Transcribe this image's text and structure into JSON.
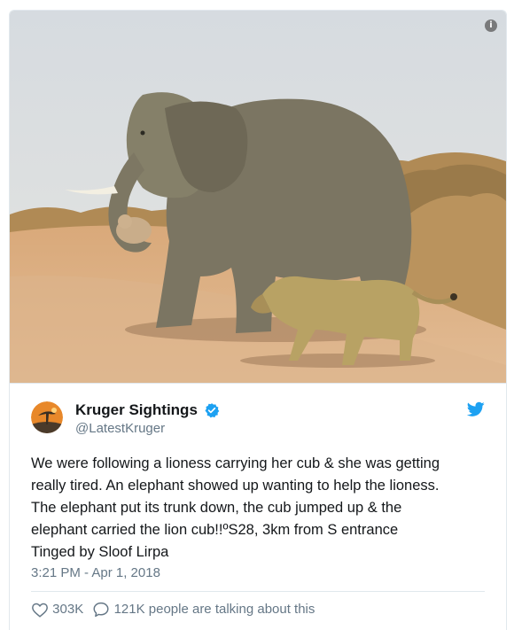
{
  "media": {
    "alt": "elephant-carrying-lion-cub-photo",
    "info_icon": "info-icon"
  },
  "author": {
    "display_name": "Kruger Sightings",
    "handle": "@LatestKruger",
    "verified": true
  },
  "tweet": {
    "text": "We were following a lioness carrying her cub & she was getting\nreally tired. An elephant showed up wanting to help the lioness.\nThe elephant put its trunk down, the cub jumped up & the\nelephant carried the lion cub!!ºS28, 3km from S entrance\nTinged by Sloof Lirpa",
    "timestamp": "3:21 PM - Apr 1, 2018"
  },
  "engagement": {
    "likes": "303K",
    "replies_text": "121K people are talking about this"
  },
  "colors": {
    "twitter_blue": "#1da1f2",
    "muted_text": "#657786",
    "avatar_orange": "#e8882a",
    "border": "#e1e8ed"
  },
  "icons": [
    "info-icon",
    "verified-badge-icon",
    "twitter-bird-icon",
    "heart-icon",
    "speech-bubble-icon"
  ]
}
